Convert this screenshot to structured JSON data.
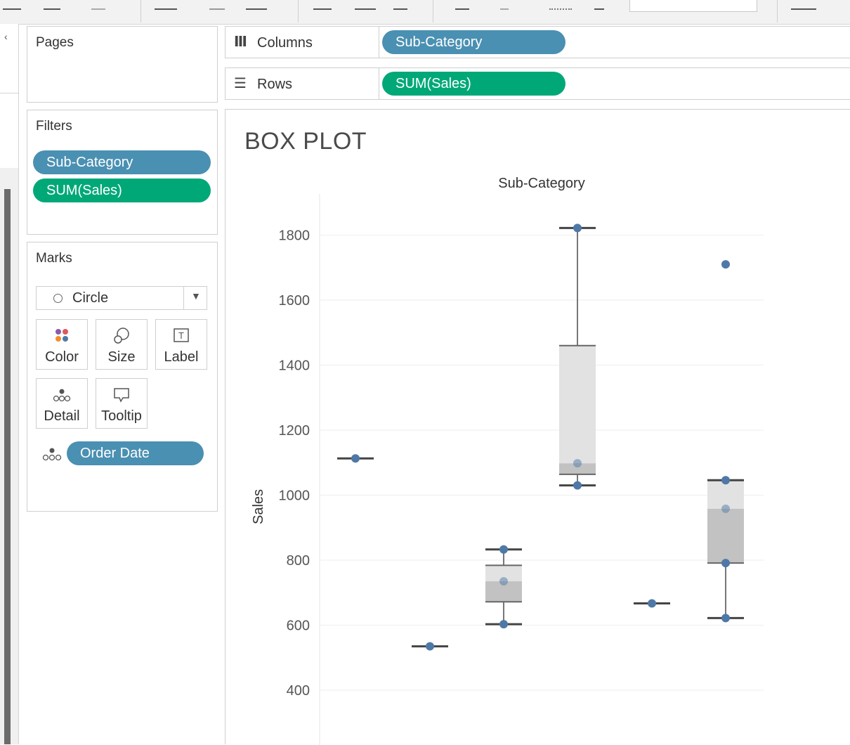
{
  "shelves": {
    "columns": {
      "label": "Columns",
      "pill": "Sub-Category"
    },
    "rows": {
      "label": "Rows",
      "pill": "SUM(Sales)"
    }
  },
  "pages": {
    "title": "Pages"
  },
  "filters": {
    "title": "Filters",
    "pills": [
      "Sub-Category",
      "SUM(Sales)"
    ]
  },
  "marks": {
    "title": "Marks",
    "mark_type": "Circle",
    "buttons": [
      "Color",
      "Size",
      "Label",
      "Detail",
      "Tooltip"
    ],
    "detail_pill": "Order Date"
  },
  "colors": {
    "blue_pill": "#4a90b2",
    "green_pill": "#00a878",
    "mark": "#4e79a7"
  },
  "view": {
    "title": "BOX PLOT"
  },
  "chart_data": {
    "type": "scatter",
    "title": "BOX PLOT",
    "column_header": "Sub-Category",
    "ylabel": "Sales",
    "xlabel": "",
    "yticks": [
      400,
      600,
      800,
      1000,
      1200,
      1400,
      1600,
      1800
    ],
    "grid": true,
    "columns": [
      {
        "points": [
          1113
        ]
      },
      {
        "points": [
          535
        ]
      },
      {
        "points": [
          603,
          735,
          833
        ],
        "box": {
          "whisker_low": 603,
          "q1": 672,
          "median": 735,
          "q3": 784,
          "whisker_high": 833
        }
      },
      {
        "points": [
          1030,
          1098,
          1822
        ],
        "box": {
          "whisker_low": 1030,
          "q1": 1064,
          "median": 1098,
          "q3": 1460,
          "whisker_high": 1822
        }
      },
      {
        "points": [
          667
        ]
      },
      {
        "points": [
          622,
          791,
          958,
          1046,
          1710
        ],
        "box": {
          "whisker_low": 622,
          "q1": 791,
          "median": 958,
          "q3": 1046,
          "whisker_high": 1046
        }
      }
    ]
  }
}
